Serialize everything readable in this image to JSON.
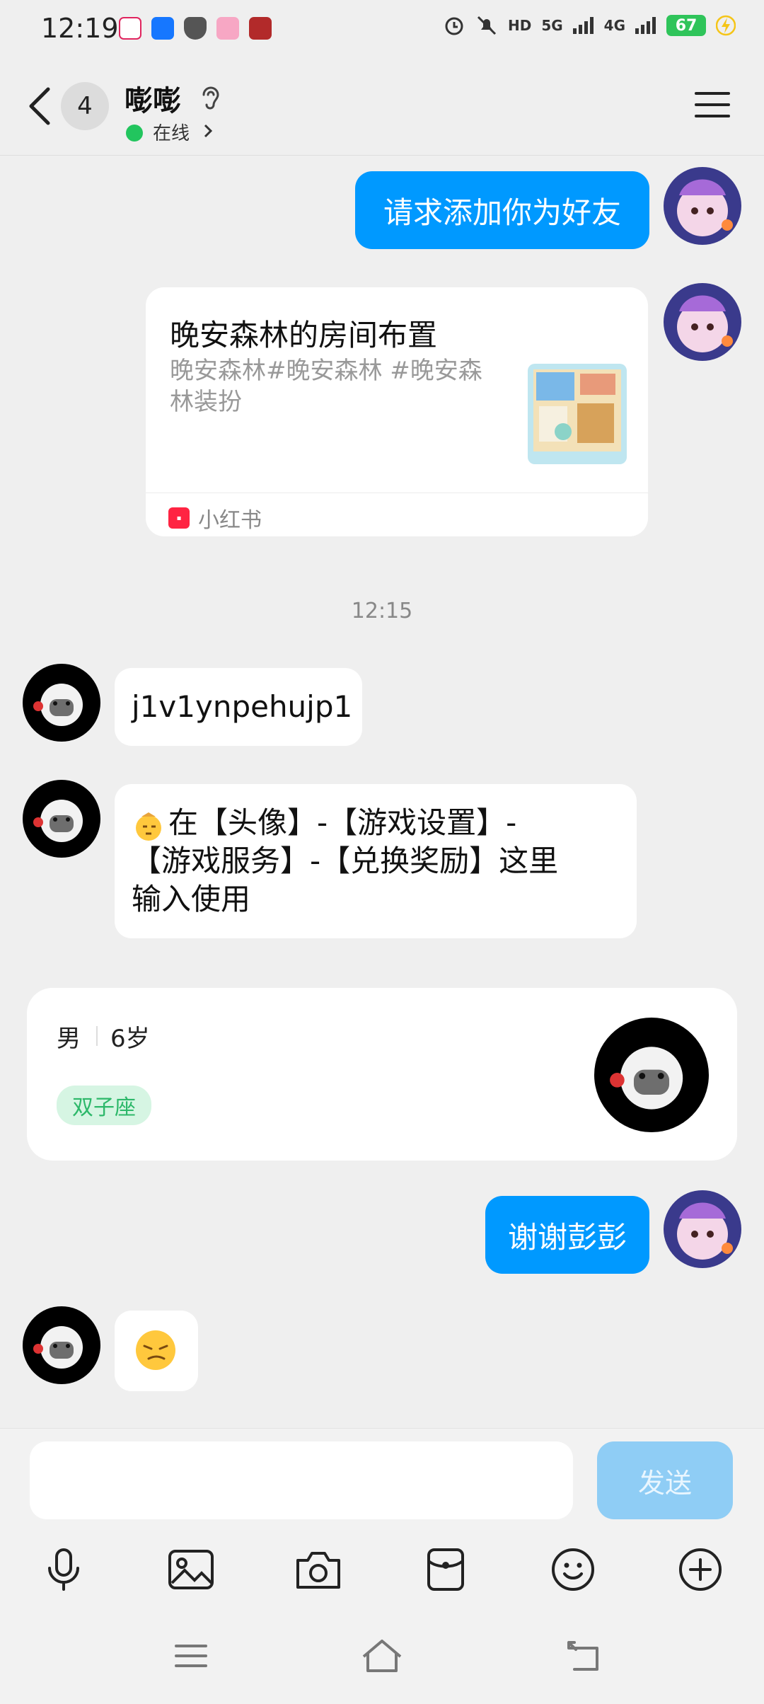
{
  "status_bar": {
    "time": "12:19",
    "network_labels": [
      "HD",
      "5G",
      "4G"
    ],
    "battery": "67"
  },
  "header": {
    "unread_count": "4",
    "contact_name": "嘭嘭",
    "status": "在线"
  },
  "messages": {
    "friend_request": "请求添加你为好友",
    "share": {
      "title": "晚安森林的房间布置",
      "desc": "晚安森林#晚安森林 #晚安森林装扮",
      "source": "小红书"
    },
    "timestamp": "12:15",
    "code": "j1v1ynpehujp1",
    "instruction": "在【头像】-【游戏设置】-【游戏服务】-【兑换奖励】这里输入使用",
    "thanks": "谢谢彭彭"
  },
  "profile_card": {
    "gender": "男",
    "age": "6岁",
    "tag": "双子座"
  },
  "input": {
    "placeholder": "",
    "send_label": "发送"
  },
  "toolbar_icons": [
    "microphone-icon",
    "image-icon",
    "camera-icon",
    "red-packet-icon",
    "emoji-icon",
    "plus-icon"
  ],
  "colors": {
    "my_bubble": "#0099ff",
    "send_disabled": "#8fcdf5",
    "online": "#22c55e",
    "tag_text": "#2db86a"
  }
}
